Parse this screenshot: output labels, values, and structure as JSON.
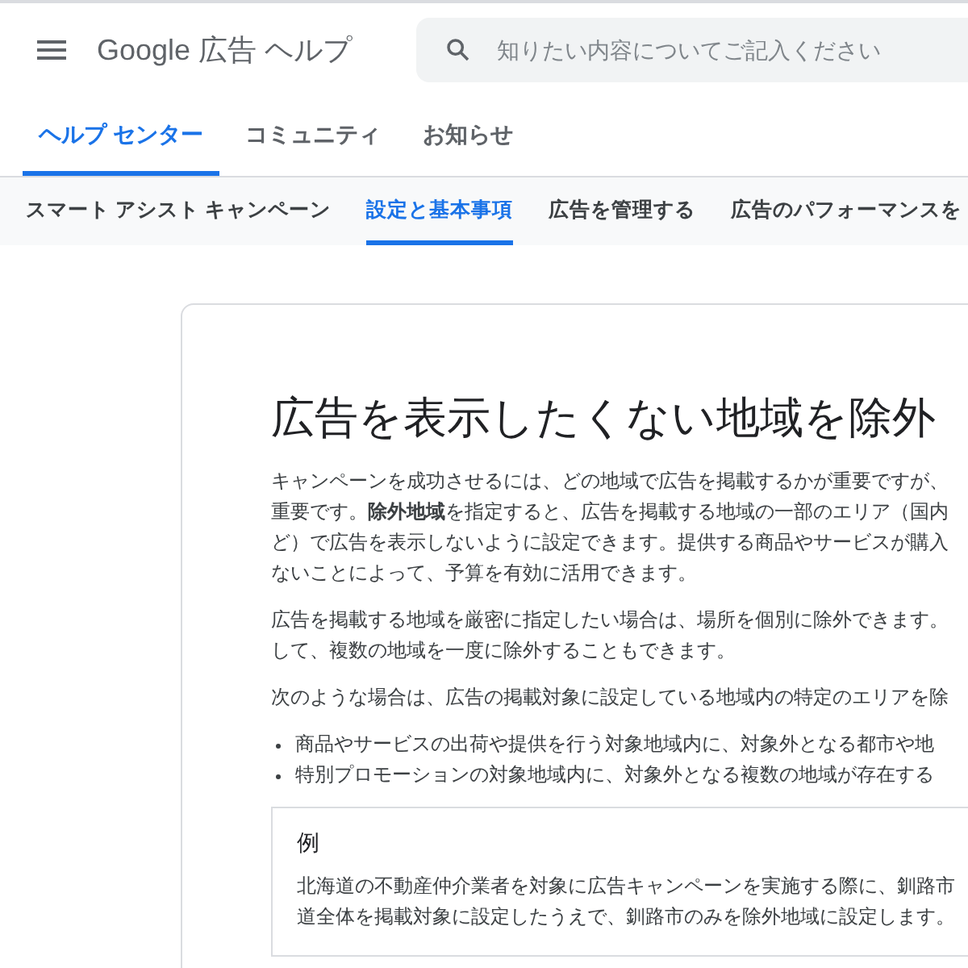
{
  "header": {
    "title": "Google 広告 ヘルプ",
    "search": {
      "placeholder": "知りたい内容についてご記入ください"
    }
  },
  "tabs": [
    {
      "label": "ヘルプ センター",
      "selected": true
    },
    {
      "label": "コミュニティ",
      "selected": false
    },
    {
      "label": "お知らせ",
      "selected": false
    }
  ],
  "subnav": [
    {
      "label": "スマート アシスト キャンペーン",
      "selected": false
    },
    {
      "label": "設定と基本事項",
      "selected": true
    },
    {
      "label": "広告を管理する",
      "selected": false
    },
    {
      "label": "広告のパフォーマンスを",
      "selected": false
    }
  ],
  "article": {
    "title": "広告を表示したくない地域を除外",
    "paragraphs": [
      [
        "キャンペーンを成功させるには、どの地域で広告を掲載するかが重要ですが、",
        "重要です。**除外地域**を指定すると、広告を掲載する地域の一部のエリア（国内",
        "ど）で広告を表示しないように設定できます。提供する商品やサービスが購入",
        "ないことによって、予算を有効に活用できます。"
      ],
      [
        "広告を掲載する地域を厳密に指定したい場合は、場所を個別に除外できます。",
        "して、複数の地域を一度に除外することもできます。"
      ],
      [
        "次のような場合は、広告の掲載対象に設定している地域内の特定のエリアを除"
      ]
    ],
    "bullets": [
      "商品やサービスの出荷や提供を行う対象地域内に、対象外となる都市や地",
      "特別プロモーションの対象地域内に、対象外となる複数の地域が存在する"
    ],
    "example": {
      "heading": "例",
      "lines": [
        "北海道の不動産仲介業者を対象に広告キャンペーンを実施する際に、釧路市",
        "道全体を掲載対象に設定したうえで、釧路市のみを除外地域に設定します。"
      ]
    }
  }
}
